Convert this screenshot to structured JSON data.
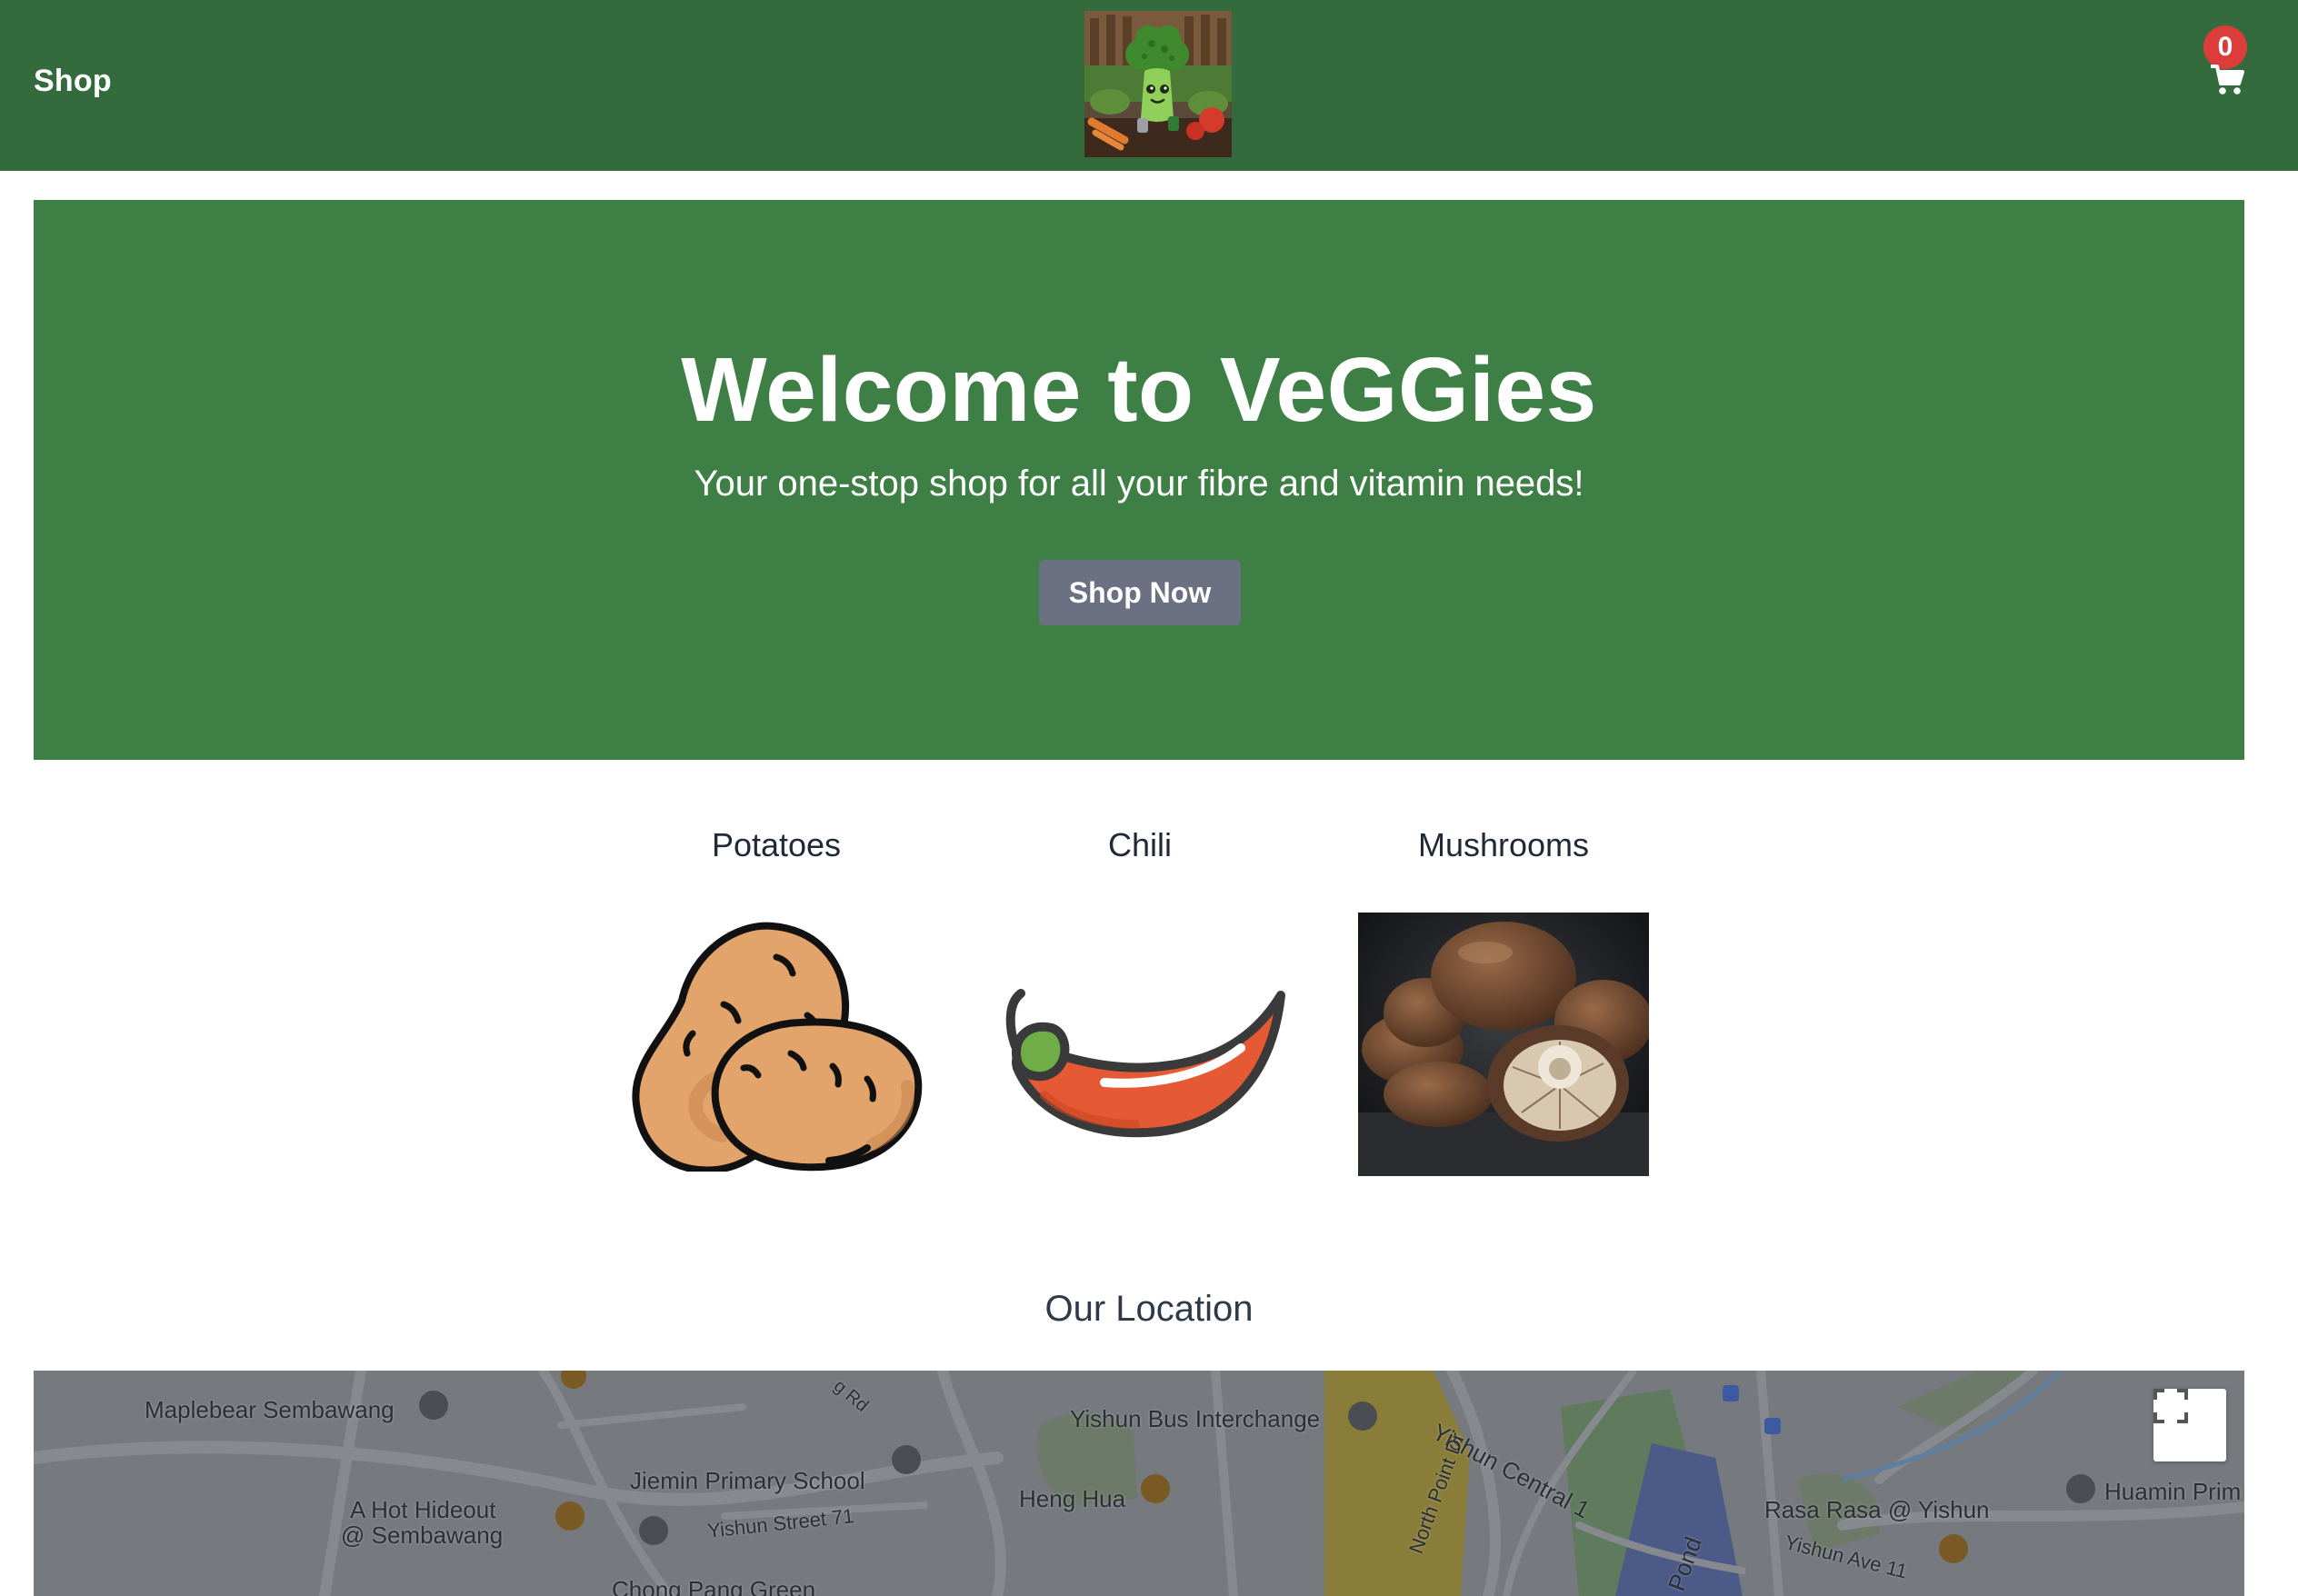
{
  "header": {
    "shop_label": "Shop",
    "cart_count": "0",
    "bar_color": "#336b3d",
    "badge_color": "#dc3d3a",
    "logo_icon": "broccoli-mascot-icon",
    "cart_icon": "shopping-cart-icon"
  },
  "hero": {
    "title": "Welcome to VeGGies",
    "subtitle": "Your one-stop shop for all your fibre and vitamin needs!",
    "button_label": "Shop Now",
    "background_color": "#3d7f44",
    "button_color": "#6b7182"
  },
  "products": [
    {
      "name": "Potatoes",
      "icon": "potato-icon"
    },
    {
      "name": "Chili",
      "icon": "chili-icon"
    },
    {
      "name": "Mushrooms",
      "icon": "mushroom-photo"
    }
  ],
  "location": {
    "title": "Our Location",
    "map_labels": [
      "Maplebear Sembawang",
      "Yishun Bus Interchange",
      "Yishun Central 1",
      "Jiemin Primary School",
      "Heng Hua",
      "A Hot Hideout",
      "@ Sembawang",
      "Yishun Street 71",
      "Chong Pang Green",
      "North Point Dr",
      "Pond",
      "Rasa Rasa @ Yishun",
      "Yishun Ave 11",
      "Huamin Prim",
      "g Rd"
    ],
    "fullscreen_icon": "fullscreen-icon"
  }
}
